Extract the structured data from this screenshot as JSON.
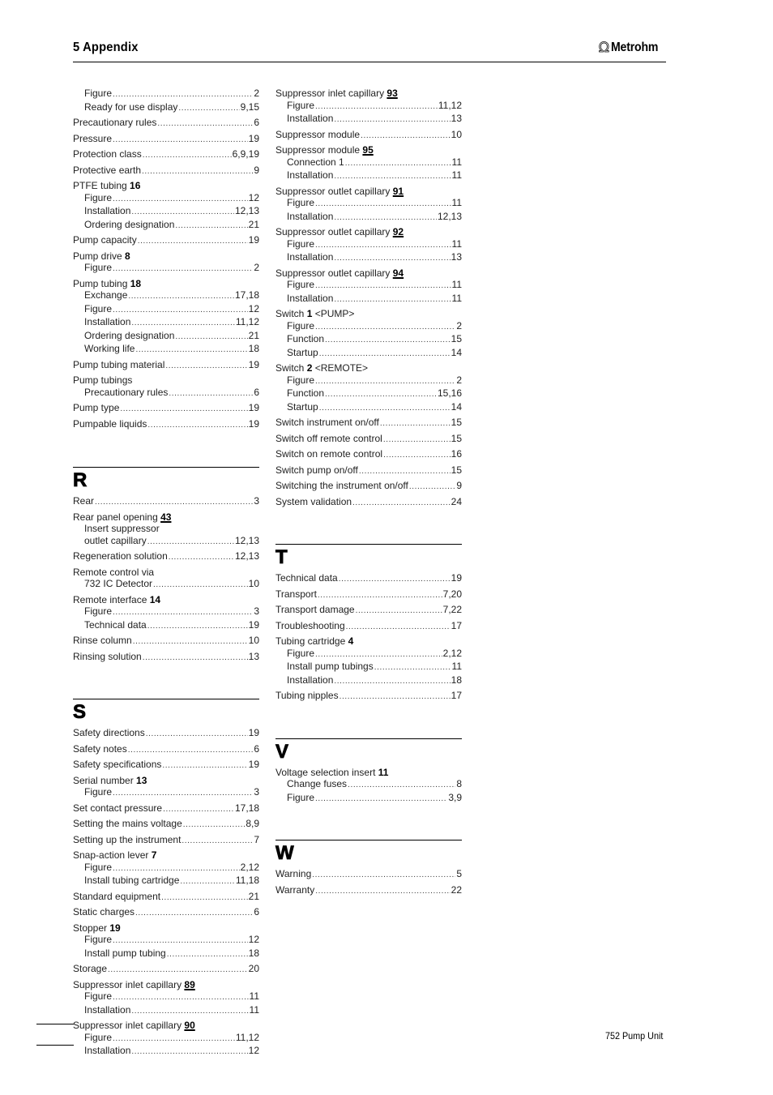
{
  "header": {
    "title": "5  Appendix",
    "logo_icon": "omega-icon",
    "logo_text": "Metrohm"
  },
  "footer": {
    "product": "752 Pump Unit"
  },
  "left_column": {
    "p_continued": [
      {
        "sub": [
          {
            "label": "Figure",
            "pages": "2"
          },
          {
            "label": "Ready for use display",
            "pages": "9,15"
          }
        ]
      },
      {
        "label": "Precautionary rules",
        "pages": "6"
      },
      {
        "label": "Pressure",
        "pages": "19"
      },
      {
        "label": "Protection class",
        "pages": "6,9,19"
      },
      {
        "label": "Protective earth",
        "pages": "9"
      },
      {
        "label": "PTFE tubing",
        "num": "16",
        "sub": [
          {
            "label": "Figure",
            "pages": "12"
          },
          {
            "label": "Installation",
            "pages": "12,13"
          },
          {
            "label": "Ordering designation",
            "pages": "21"
          }
        ]
      },
      {
        "label": "Pump capacity",
        "pages": "19"
      },
      {
        "label": "Pump drive",
        "num": "8",
        "sub": [
          {
            "label": "Figure",
            "pages": "2"
          }
        ]
      },
      {
        "label": "Pump tubing",
        "num": "18",
        "sub": [
          {
            "label": "Exchange",
            "pages": "17,18"
          },
          {
            "label": "Figure",
            "pages": "12"
          },
          {
            "label": "Installation",
            "pages": "11,12"
          },
          {
            "label": "Ordering designation",
            "pages": "21"
          },
          {
            "label": "Working life",
            "pages": "18"
          }
        ]
      },
      {
        "label": "Pump tubing material",
        "pages": "19"
      },
      {
        "label": "Pump tubings",
        "sub": [
          {
            "label": "Precautionary rules",
            "pages": "6"
          }
        ]
      },
      {
        "label": "Pump type",
        "pages": "19"
      },
      {
        "label": "Pumpable liquids",
        "pages": "19"
      }
    ],
    "r": {
      "letter": "R",
      "entries": [
        {
          "label": "Rear",
          "pages": "3"
        },
        {
          "label": "Rear panel opening",
          "num": "43",
          "num_underlined": true,
          "sub": [
            {
              "label": "Insert suppressor",
              "pages": ""
            },
            {
              "label": "outlet capillary",
              "pages": "12,13"
            }
          ]
        },
        {
          "label": "Regeneration solution",
          "pages": "12,13"
        },
        {
          "label": "Remote control via",
          "sub": [
            {
              "label": "732 IC Detector",
              "pages": "10"
            }
          ]
        },
        {
          "label": "Remote interface",
          "num": "14",
          "sub": [
            {
              "label": "Figure",
              "pages": "3"
            },
            {
              "label": "Technical data",
              "pages": "19"
            }
          ]
        },
        {
          "label": "Rinse column",
          "pages": "10"
        },
        {
          "label": "Rinsing solution",
          "pages": "13"
        }
      ]
    },
    "s": {
      "letter": "S",
      "entries": [
        {
          "label": "Safety directions",
          "pages": "19"
        },
        {
          "label": "Safety notes",
          "pages": "6"
        },
        {
          "label": "Safety specifications",
          "pages": "19"
        },
        {
          "label": "Serial number",
          "num": "13",
          "sub": [
            {
              "label": "Figure",
              "pages": "3"
            }
          ]
        },
        {
          "label": "Set contact pressure",
          "pages": "17,18"
        },
        {
          "label": "Setting the mains voltage",
          "pages": "8,9"
        },
        {
          "label": "Setting up the instrument",
          "pages": "7"
        },
        {
          "label": "Snap-action lever",
          "num": "7",
          "sub": [
            {
              "label": "Figure",
              "pages": "2,12"
            },
            {
              "label": "Install tubing cartridge",
              "pages": "11,18"
            }
          ]
        },
        {
          "label": "Standard equipment",
          "pages": "21"
        },
        {
          "label": "Static charges",
          "pages": "6"
        },
        {
          "label": "Stopper",
          "num": "19",
          "sub": [
            {
              "label": "Figure",
              "pages": "12"
            },
            {
              "label": "Install pump tubing",
              "pages": "18"
            }
          ]
        },
        {
          "label": "Storage",
          "pages": "20"
        },
        {
          "label": "Suppressor inlet capillary",
          "num": "89",
          "num_underlined": true,
          "sub": [
            {
              "label": "Figure",
              "pages": "11"
            },
            {
              "label": "Installation",
              "pages": "11"
            }
          ]
        },
        {
          "label": "Suppressor inlet capillary",
          "num": "90",
          "num_underlined": true,
          "sub": [
            {
              "label": "Figure",
              "pages": "11,12"
            },
            {
              "label": "Installation",
              "pages": "12"
            }
          ]
        }
      ]
    }
  },
  "right_column": {
    "s_continued": [
      {
        "label": "Suppressor inlet capillary",
        "num": "93",
        "num_underlined": true,
        "sub": [
          {
            "label": "Figure",
            "pages": "11,12"
          },
          {
            "label": "Installation",
            "pages": "13"
          }
        ]
      },
      {
        "label": "Suppressor module",
        "pages": "10"
      },
      {
        "label": "Suppressor module",
        "num": "95",
        "num_underlined": true,
        "sub": [
          {
            "label": "Connection 1",
            "pages": "11"
          },
          {
            "label": "Installation",
            "pages": "11"
          }
        ]
      },
      {
        "label": "Suppressor outlet capillary",
        "num": "91",
        "num_underlined": true,
        "sub": [
          {
            "label": "Figure",
            "pages": "11"
          },
          {
            "label": "Installation",
            "pages": "12,13"
          }
        ]
      },
      {
        "label": "Suppressor outlet capillary",
        "num": "92",
        "num_underlined": true,
        "sub": [
          {
            "label": "Figure",
            "pages": "11"
          },
          {
            "label": "Installation",
            "pages": "13"
          }
        ]
      },
      {
        "label": "Suppressor outlet capillary",
        "num": "94",
        "num_underlined": true,
        "sub": [
          {
            "label": "Figure",
            "pages": "11"
          },
          {
            "label": "Installation",
            "pages": "11"
          }
        ]
      },
      {
        "label": "Switch",
        "num": "1",
        "suffix": " <PUMP>",
        "sub": [
          {
            "label": "Figure",
            "pages": "2"
          },
          {
            "label": "Function",
            "pages": "15"
          },
          {
            "label": "Startup",
            "pages": "14"
          }
        ]
      },
      {
        "label": "Switch",
        "num": "2",
        "suffix": " <REMOTE>",
        "sub": [
          {
            "label": "Figure",
            "pages": "2"
          },
          {
            "label": "Function",
            "pages": "15,16"
          },
          {
            "label": "Startup",
            "pages": "14"
          }
        ]
      },
      {
        "label": "Switch instrument on/off",
        "pages": "15"
      },
      {
        "label": "Switch off remote control",
        "pages": "15"
      },
      {
        "label": "Switch on remote control",
        "pages": "16"
      },
      {
        "label": "Switch pump on/off",
        "pages": "15"
      },
      {
        "label": "Switching the instrument on/off",
        "pages": "9"
      },
      {
        "label": "System validation",
        "pages": "24"
      }
    ],
    "t": {
      "letter": "T",
      "entries": [
        {
          "label": "Technical data",
          "pages": "19"
        },
        {
          "label": "Transport",
          "pages": "7,20"
        },
        {
          "label": "Transport damage",
          "pages": "7,22"
        },
        {
          "label": "Troubleshooting",
          "pages": "17"
        },
        {
          "label": "Tubing cartridge",
          "num": "4",
          "sub": [
            {
              "label": "Figure",
              "pages": "2,12"
            },
            {
              "label": "Install pump tubings",
              "pages": "11"
            },
            {
              "label": "Installation",
              "pages": "18"
            }
          ]
        },
        {
          "label": "Tubing nipples",
          "pages": "17"
        }
      ]
    },
    "v": {
      "letter": "V",
      "entries": [
        {
          "label": "Voltage selection insert",
          "num": "11",
          "sub": [
            {
              "label": "Change fuses",
              "pages": "8"
            },
            {
              "label": "Figure",
              "pages": "3,9"
            }
          ]
        }
      ]
    },
    "w": {
      "letter": "W",
      "entries": [
        {
          "label": "Warning",
          "pages": "5"
        },
        {
          "label": "Warranty",
          "pages": "22"
        }
      ]
    }
  }
}
